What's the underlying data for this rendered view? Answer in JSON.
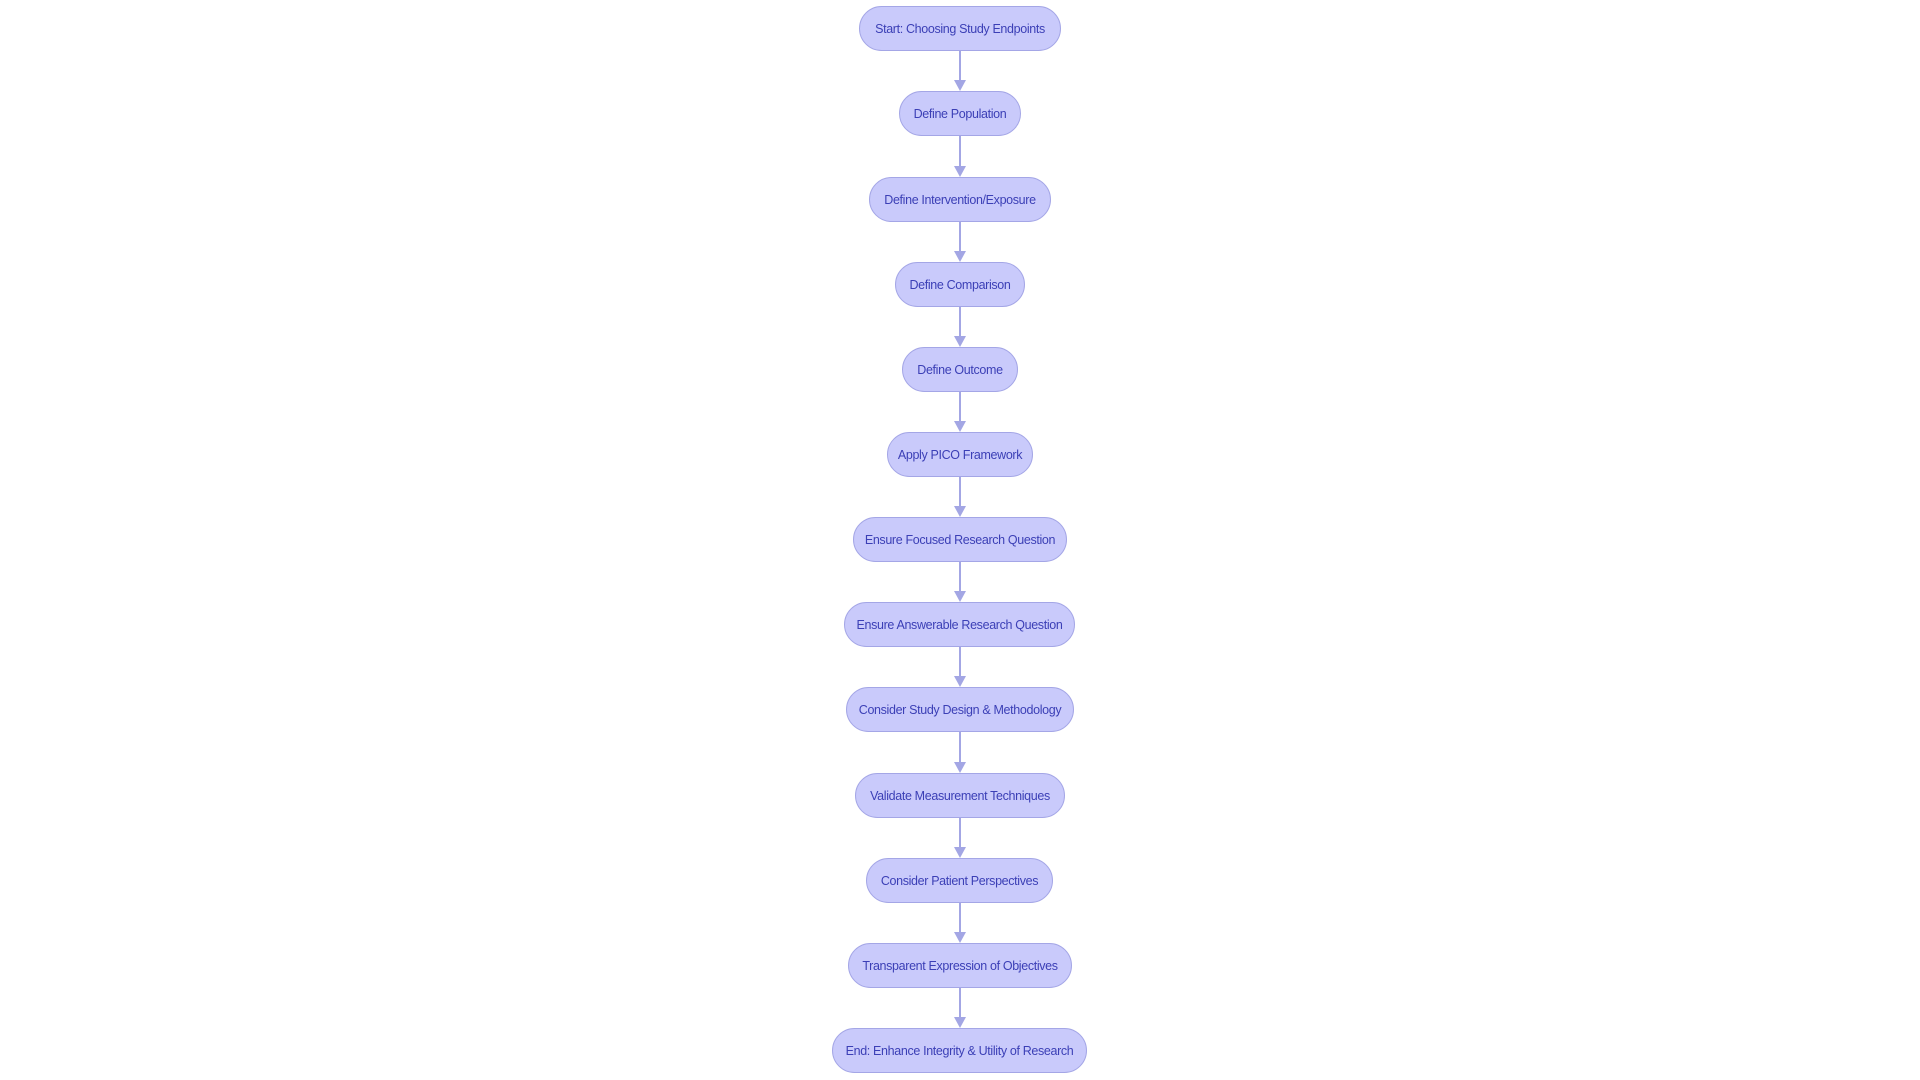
{
  "diagram": {
    "type": "flowchart",
    "direction": "top-to-bottom",
    "colors": {
      "node_fill": "#c9cafb",
      "node_border": "#a4a6e6",
      "node_text": "#3b3fb6",
      "edge": "#a3a6e4",
      "background": "#ffffff"
    },
    "nodes": [
      {
        "id": "start",
        "label": "Start: Choosing Study Endpoints"
      },
      {
        "id": "population",
        "label": "Define Population"
      },
      {
        "id": "intervention",
        "label": "Define Intervention/Exposure"
      },
      {
        "id": "comparison",
        "label": "Define Comparison"
      },
      {
        "id": "outcome",
        "label": "Define Outcome"
      },
      {
        "id": "pico",
        "label": "Apply PICO Framework"
      },
      {
        "id": "focused",
        "label": "Ensure Focused Research Question"
      },
      {
        "id": "answerable",
        "label": "Ensure Answerable Research Question"
      },
      {
        "id": "design",
        "label": "Consider Study Design & Methodology"
      },
      {
        "id": "validate",
        "label": "Validate Measurement Techniques"
      },
      {
        "id": "patient",
        "label": "Consider Patient Perspectives"
      },
      {
        "id": "objectives",
        "label": "Transparent Expression of Objectives"
      },
      {
        "id": "end",
        "label": "End: Enhance Integrity & Utility of Research"
      }
    ],
    "edges": [
      {
        "from": "start",
        "to": "population"
      },
      {
        "from": "population",
        "to": "intervention"
      },
      {
        "from": "intervention",
        "to": "comparison"
      },
      {
        "from": "comparison",
        "to": "outcome"
      },
      {
        "from": "outcome",
        "to": "pico"
      },
      {
        "from": "pico",
        "to": "focused"
      },
      {
        "from": "focused",
        "to": "answerable"
      },
      {
        "from": "answerable",
        "to": "design"
      },
      {
        "from": "design",
        "to": "validate"
      },
      {
        "from": "validate",
        "to": "patient"
      },
      {
        "from": "patient",
        "to": "objectives"
      },
      {
        "from": "objectives",
        "to": "end"
      }
    ]
  }
}
